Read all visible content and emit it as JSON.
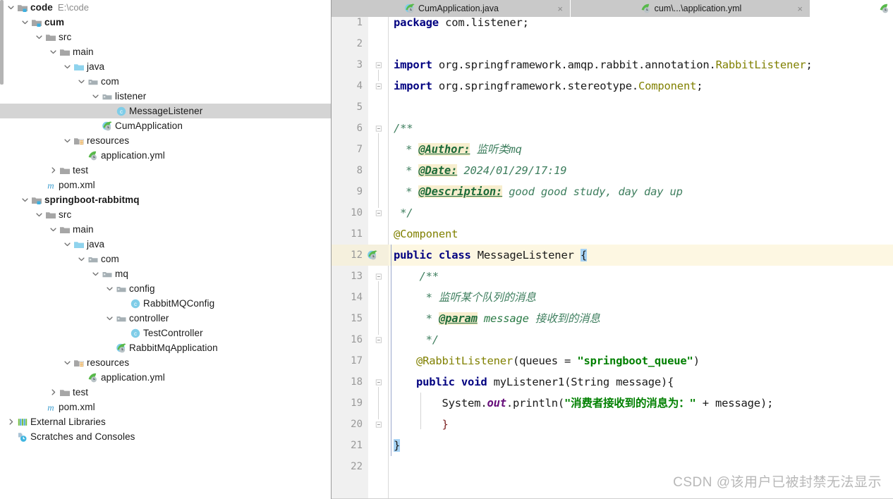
{
  "project_tree": {
    "name": "project-tool-window",
    "rows": [
      {
        "indent": 0,
        "twisty": "expanded",
        "icon": "module-folder-icon",
        "label": "code",
        "bold": true,
        "sub": "E:\\code"
      },
      {
        "indent": 1,
        "twisty": "expanded",
        "icon": "module-folder-icon",
        "label": "cum",
        "bold": true,
        "sub": ""
      },
      {
        "indent": 2,
        "twisty": "expanded",
        "icon": "folder-icon",
        "label": "src",
        "bold": false,
        "sub": ""
      },
      {
        "indent": 3,
        "twisty": "expanded",
        "icon": "folder-icon",
        "label": "main",
        "bold": false,
        "sub": ""
      },
      {
        "indent": 4,
        "twisty": "expanded",
        "icon": "source-root-folder-icon",
        "label": "java",
        "bold": false,
        "sub": ""
      },
      {
        "indent": 5,
        "twisty": "expanded",
        "icon": "package-icon",
        "label": "com",
        "bold": false,
        "sub": ""
      },
      {
        "indent": 6,
        "twisty": "expanded",
        "icon": "package-icon",
        "label": "listener",
        "bold": false,
        "sub": ""
      },
      {
        "indent": 7,
        "twisty": "none",
        "icon": "java-class-icon",
        "label": "MessageListener",
        "bold": false,
        "sub": "",
        "selected": true
      },
      {
        "indent": 6,
        "twisty": "none",
        "icon": "spring-boot-class-icon",
        "label": "CumApplication",
        "bold": false,
        "sub": ""
      },
      {
        "indent": 4,
        "twisty": "expanded",
        "icon": "resources-folder-icon",
        "label": "resources",
        "bold": false,
        "sub": ""
      },
      {
        "indent": 5,
        "twisty": "none",
        "icon": "spring-yml-icon",
        "label": "application.yml",
        "bold": false,
        "sub": ""
      },
      {
        "indent": 3,
        "twisty": "collapsed",
        "icon": "folder-icon",
        "label": "test",
        "bold": false,
        "sub": ""
      },
      {
        "indent": 2,
        "twisty": "none",
        "icon": "maven-icon",
        "label": "pom.xml",
        "bold": false,
        "sub": ""
      },
      {
        "indent": 1,
        "twisty": "expanded",
        "icon": "module-folder-icon",
        "label": "springboot-rabbitmq",
        "bold": true,
        "sub": ""
      },
      {
        "indent": 2,
        "twisty": "expanded",
        "icon": "folder-icon",
        "label": "src",
        "bold": false,
        "sub": ""
      },
      {
        "indent": 3,
        "twisty": "expanded",
        "icon": "folder-icon",
        "label": "main",
        "bold": false,
        "sub": ""
      },
      {
        "indent": 4,
        "twisty": "expanded",
        "icon": "source-root-folder-icon",
        "label": "java",
        "bold": false,
        "sub": ""
      },
      {
        "indent": 5,
        "twisty": "expanded",
        "icon": "package-icon",
        "label": "com",
        "bold": false,
        "sub": ""
      },
      {
        "indent": 6,
        "twisty": "expanded",
        "icon": "package-icon",
        "label": "mq",
        "bold": false,
        "sub": ""
      },
      {
        "indent": 7,
        "twisty": "expanded",
        "icon": "package-icon",
        "label": "config",
        "bold": false,
        "sub": ""
      },
      {
        "indent": 8,
        "twisty": "none",
        "icon": "java-class-icon",
        "label": "RabbitMQConfig",
        "bold": false,
        "sub": ""
      },
      {
        "indent": 7,
        "twisty": "expanded",
        "icon": "package-icon",
        "label": "controller",
        "bold": false,
        "sub": ""
      },
      {
        "indent": 8,
        "twisty": "none",
        "icon": "java-class-icon",
        "label": "TestController",
        "bold": false,
        "sub": ""
      },
      {
        "indent": 7,
        "twisty": "none",
        "icon": "spring-boot-class-icon",
        "label": "RabbitMqApplication",
        "bold": false,
        "sub": ""
      },
      {
        "indent": 4,
        "twisty": "expanded",
        "icon": "resources-folder-icon",
        "label": "resources",
        "bold": false,
        "sub": ""
      },
      {
        "indent": 5,
        "twisty": "none",
        "icon": "spring-yml-icon",
        "label": "application.yml",
        "bold": false,
        "sub": ""
      },
      {
        "indent": 3,
        "twisty": "collapsed",
        "icon": "folder-icon",
        "label": "test",
        "bold": false,
        "sub": ""
      },
      {
        "indent": 2,
        "twisty": "none",
        "icon": "maven-icon",
        "label": "pom.xml",
        "bold": false,
        "sub": ""
      },
      {
        "indent": 0,
        "twisty": "collapsed",
        "icon": "external-libraries-icon",
        "label": "External Libraries",
        "bold": false,
        "sub": ""
      },
      {
        "indent": 0,
        "twisty": "none",
        "icon": "scratches-icon",
        "label": "Scratches and Consoles",
        "bold": false,
        "sub": ""
      }
    ]
  },
  "editor": {
    "tabs": [
      {
        "label": "CumApplication.java",
        "icon": "spring-boot-class-icon",
        "close": "×",
        "active": false
      },
      {
        "label": "cum\\...\\application.yml",
        "icon": "spring-yml-icon",
        "close": "×",
        "active": true
      },
      {
        "label": "",
        "icon": "spring-yml-icon",
        "close": "",
        "active": false
      }
    ],
    "line_numbers": [
      "1",
      "2",
      "3",
      "4",
      "5",
      "6",
      "7",
      "8",
      "9",
      "10",
      "11",
      "12",
      "13",
      "14",
      "15",
      "16",
      "17",
      "18",
      "19",
      "20",
      "21",
      "22"
    ],
    "caret_line": 12,
    "watermark": "CSDN @该用户已被封禁无法显示",
    "code": {
      "l1_kw": "package",
      "l1_pkg": " com.",
      "l1_name": "listener",
      "l1_end": ";",
      "l3_kw": "import",
      "l3_pkg": " org.springframework.amqp.rabbit.annotation.",
      "l3_cls": "RabbitListener",
      "l3_end": ";",
      "l4_kw": "import",
      "l4_pkg": " org.springframework.stereotype.",
      "l4_cls": "Component",
      "l4_end": ";",
      "l6": "/**",
      "l7_star": " * ",
      "l7_tag": "@Author:",
      "l7_text": " 监听类mq",
      "l8_star": " * ",
      "l8_tag": "@Date:",
      "l8_text": " 2024/01/29/17:19",
      "l9_star": " * ",
      "l9_tag": "@Description:",
      "l9_text": " good good study, day day up",
      "l10": " */",
      "l11": "@Component",
      "l12_kw1": "public",
      "l12_kw2": " class",
      "l12_name": " MessageListener ",
      "l12_brace": "{",
      "l13": "    /**",
      "l14": "     * 监听某个队列的消息",
      "l15_star": "     * ",
      "l15_tag": "@param",
      "l15_param": " message",
      "l15_text": " 接收到的消息",
      "l16": "     */",
      "l17_anno": "@RabbitListener",
      "l17_mid": "(queues = ",
      "l17_str": "\"springboot_queue\"",
      "l17_end": ")",
      "l18_kw1": "public",
      "l18_kw2": " void",
      "l18_name": " myListener1",
      "l18_args": "(String message)",
      "l18_brace": "{",
      "l19_pre": "    System.",
      "l19_fld": "out",
      "l19_mid": ".println(",
      "l19_str": "\"消费者接收到的消息为：\"",
      "l19_post": " + message);",
      "l20": "    }",
      "l21": "}"
    }
  },
  "colors": {
    "keyword": "#000080",
    "string": "#008000",
    "comment": "#3f7f5f",
    "annotation": "#808000",
    "javadoc_tag_bg": "#f7eece",
    "caret_row_bg": "#fdf7e2",
    "selection_bg": "#d4d4d4",
    "brace_highlight": "#a6d2f4",
    "gutter_bg": "#f0f0f0"
  }
}
